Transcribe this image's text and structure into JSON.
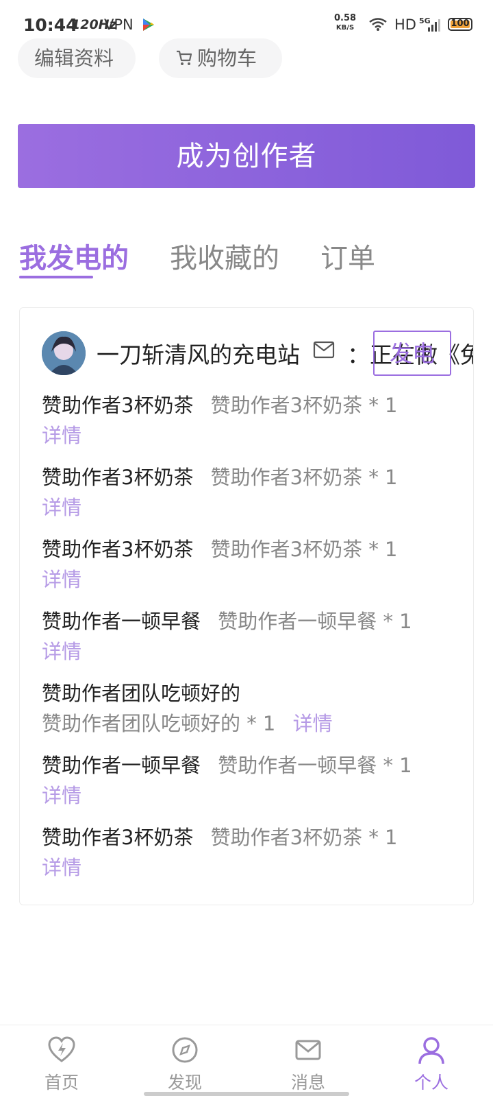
{
  "status_bar": {
    "time": "10:44",
    "refresh_rate": "120Hz",
    "vpn": "VPN",
    "speed_value": "0.58",
    "speed_unit": "KB/S",
    "hd": "HD",
    "network": "5G",
    "battery": "100",
    "battery_color": "#f0a23a"
  },
  "quick_actions": {
    "edit_profile": "编辑资料",
    "cart": "购物车"
  },
  "creator_button": "成为创作者",
  "tabs": [
    {
      "label": "我发电的",
      "active": true
    },
    {
      "label": "我收藏的",
      "active": false
    },
    {
      "label": "订单",
      "active": false
    }
  ],
  "card": {
    "station_name": "一刀斩清风的充电站",
    "status": "：正在做《兔羊",
    "charge_button": "发电",
    "items": [
      {
        "name": "赞助作者3杯奶茶",
        "desc": "赞助作者3杯奶茶 * 1",
        "detail": "详情"
      },
      {
        "name": "赞助作者3杯奶茶",
        "desc": "赞助作者3杯奶茶 * 1",
        "detail": "详情"
      },
      {
        "name": "赞助作者3杯奶茶",
        "desc": "赞助作者3杯奶茶 * 1",
        "detail": "详情"
      },
      {
        "name": "赞助作者一顿早餐",
        "desc": "赞助作者一顿早餐 * 1",
        "detail": "详情"
      },
      {
        "name": "赞助作者团队吃顿好的",
        "desc": "赞助作者团队吃顿好的 * 1",
        "detail": "详情"
      },
      {
        "name": "赞助作者一顿早餐",
        "desc": "赞助作者一顿早餐 * 1",
        "detail": "详情"
      },
      {
        "name": "赞助作者3杯奶茶",
        "desc": "赞助作者3杯奶茶 * 1",
        "detail": "详情"
      }
    ]
  },
  "bottom_nav": [
    {
      "label": "首页",
      "icon": "heart-bolt-icon",
      "active": false
    },
    {
      "label": "发现",
      "icon": "compass-icon",
      "active": false
    },
    {
      "label": "消息",
      "icon": "mail-icon",
      "active": false
    },
    {
      "label": "个人",
      "icon": "person-icon",
      "active": true
    }
  ],
  "colors": {
    "accent": "#9b6ee0",
    "detail_link": "#b69be6",
    "muted_text": "#888888"
  }
}
